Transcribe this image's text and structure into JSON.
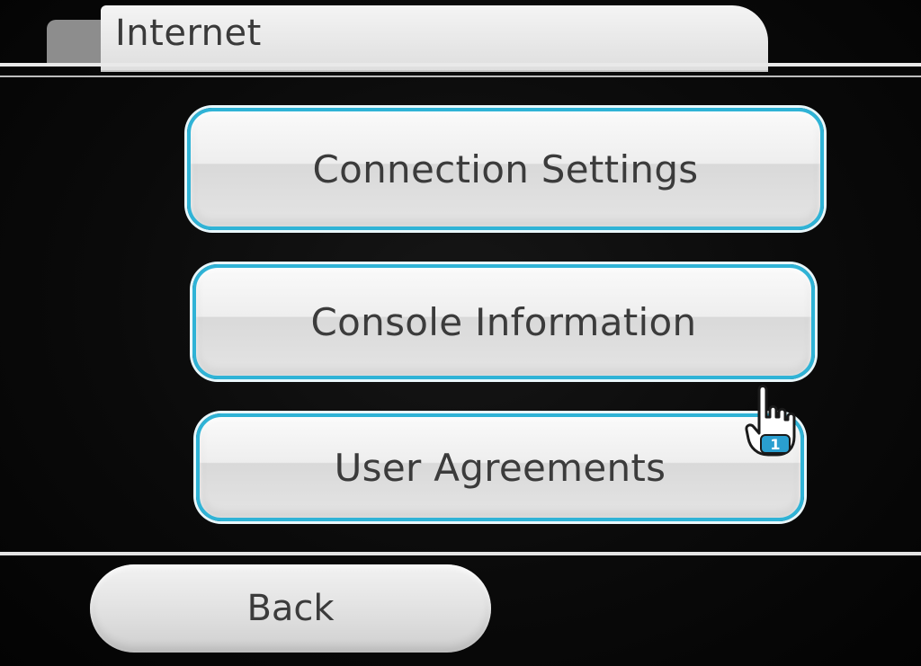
{
  "header": {
    "title": "Internet"
  },
  "menu": {
    "items": [
      {
        "label": "Connection Settings"
      },
      {
        "label": "Console Information"
      },
      {
        "label": "User Agreements"
      }
    ]
  },
  "footer": {
    "back_label": "Back"
  },
  "cursor": {
    "player_number": "1",
    "icon": "hand-pointer-icon"
  },
  "colors": {
    "accent": "#2fb3d6",
    "button_face": "#eeeeee",
    "background": "#050505",
    "text": "#3b3b3b"
  }
}
